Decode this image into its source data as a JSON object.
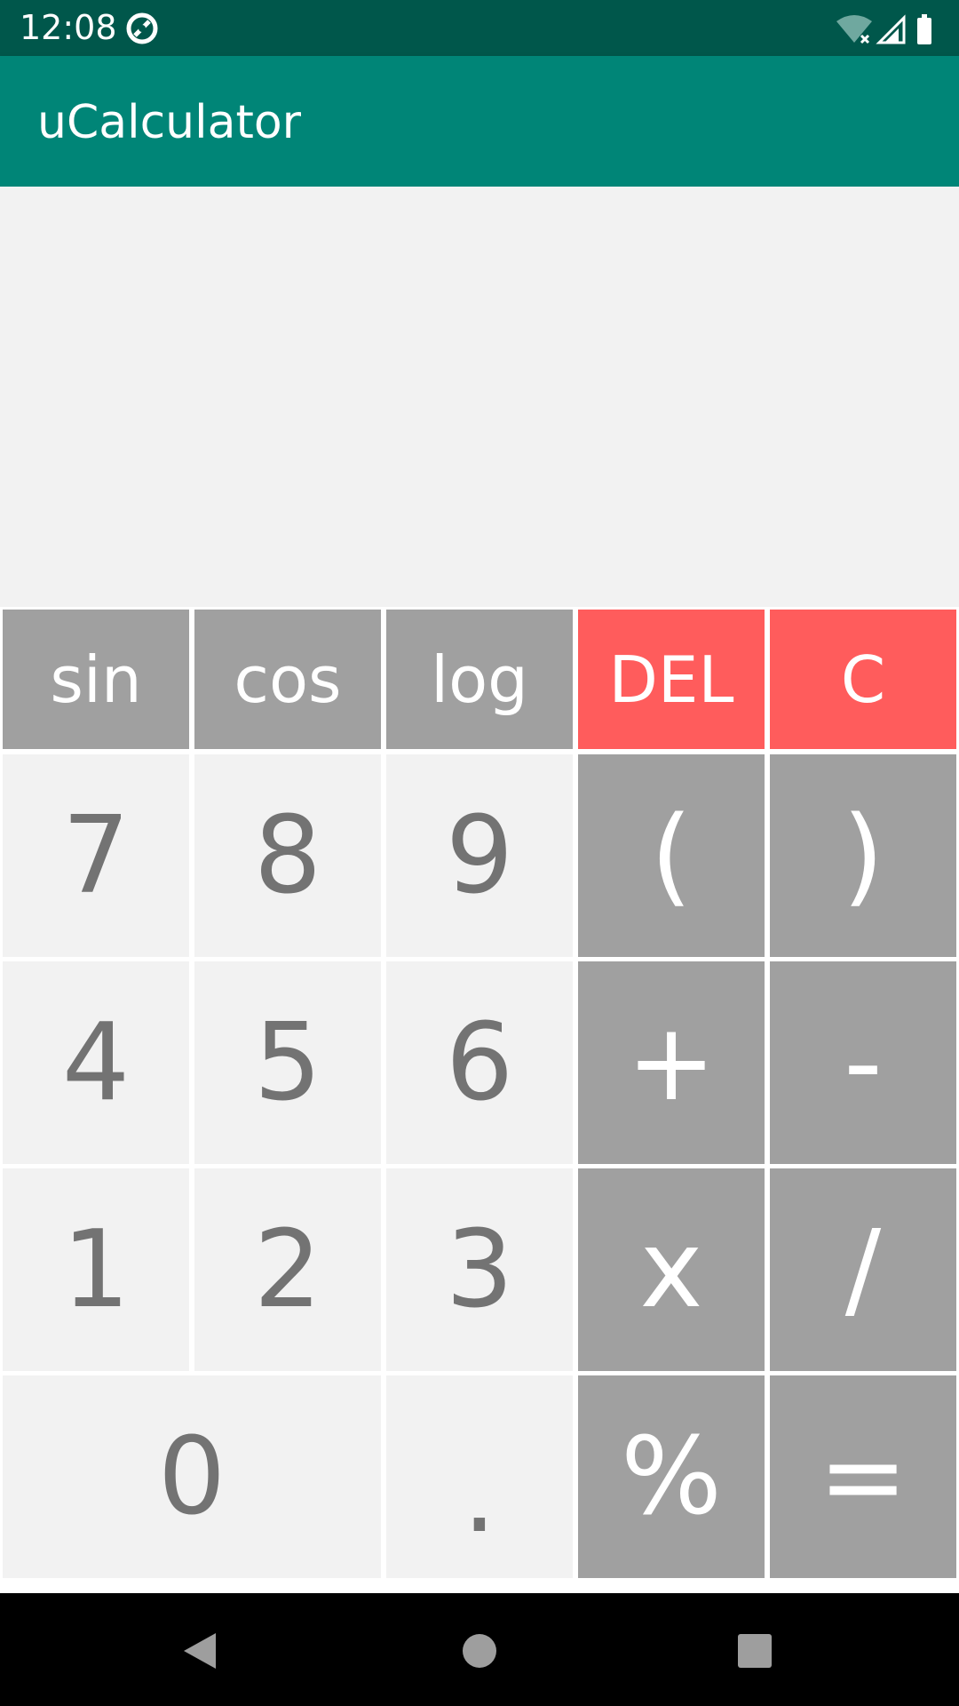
{
  "status": {
    "time": "12:08"
  },
  "app": {
    "title": "uCalculator",
    "accent_color": "#008577",
    "status_color": "#00574b"
  },
  "display": {
    "expression": "",
    "result": ""
  },
  "keys": {
    "sin": "sin",
    "cos": "cos",
    "log": "log",
    "del": "DEL",
    "clear": "C",
    "seven": "7",
    "eight": "8",
    "nine": "9",
    "lparen": "(",
    "rparen": ")",
    "four": "4",
    "five": "5",
    "six": "6",
    "plus": "+",
    "minus": "-",
    "one": "1",
    "two": "2",
    "three": "3",
    "times": "x",
    "divide": "/",
    "zero": "0",
    "dot": ".",
    "percent": "%",
    "equals": "="
  },
  "colors": {
    "function_key": "#a0a0a0",
    "delete_key": "#ff5c5c",
    "number_key": "#f2f2f2",
    "number_text": "#737373"
  },
  "icons": {
    "status_app": "sync-icon",
    "wifi": "wifi-icon",
    "signal": "signal-icon",
    "battery": "battery-icon",
    "nav_back": "back-icon",
    "nav_home": "home-icon",
    "nav_recents": "recents-icon"
  }
}
